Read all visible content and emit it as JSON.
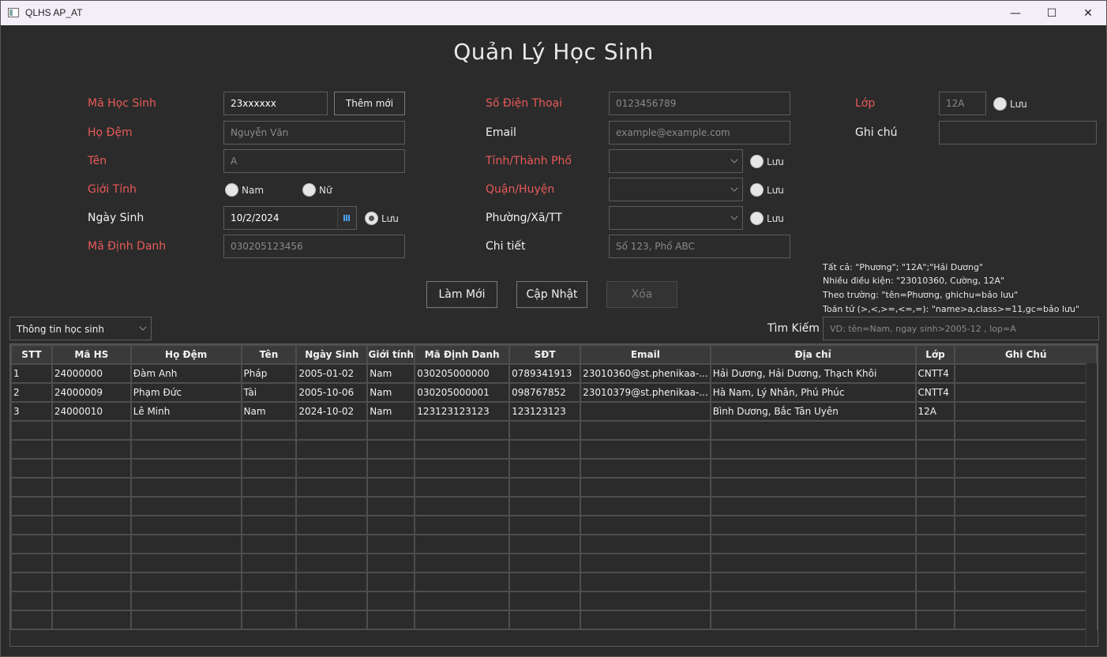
{
  "window": {
    "title": "QLHS AP_AT",
    "minimize": "—",
    "maximize": "☐",
    "close": "✕"
  },
  "header": {
    "title": "Quản Lý Học Sinh"
  },
  "form": {
    "ma_hs": {
      "label": "Mã Học Sinh",
      "value": "23xxxxxx",
      "add_button": "Thêm mới"
    },
    "ho_dem": {
      "label": "Họ Đệm",
      "placeholder": "Nguyễn Văn"
    },
    "ten": {
      "label": "Tên",
      "placeholder": "A"
    },
    "gioi_tinh": {
      "label": "Giới Tính",
      "opt_male": "Nam",
      "opt_female": "Nữ"
    },
    "ngay_sinh": {
      "label": "Ngày Sinh",
      "value": "10/2/2024",
      "save_label": "Lưu"
    },
    "ma_dinh_danh": {
      "label": "Mã Định Danh",
      "placeholder": "030205123456"
    },
    "sdt": {
      "label": "Số Điện Thoại",
      "placeholder": "0123456789"
    },
    "email": {
      "label": "Email",
      "placeholder": "example@example.com"
    },
    "tinh": {
      "label": "Tỉnh/Thành Phố",
      "save_label": "Lưu"
    },
    "quan": {
      "label": "Quận/Huyện",
      "save_label": "Lưu"
    },
    "phuong": {
      "label": "Phường/Xã/TT",
      "save_label": "Lưu"
    },
    "chi_tiet": {
      "label": "Chi tiết",
      "placeholder": "Số 123, Phố ABC"
    },
    "lop": {
      "label": "Lớp",
      "placeholder": "12A",
      "save_label": "Lưu"
    },
    "ghi_chu": {
      "label": "Ghi chú",
      "value": ""
    }
  },
  "actions": {
    "refresh": "Làm Mới",
    "update": "Cập Nhật",
    "delete": "Xóa"
  },
  "hints": {
    "line1": "Tất cả: \"Phương\"; \"12A\";\"Hải Dương\"",
    "line2": "Nhiều điều kiện: \"23010360, Cường, 12A\"",
    "line3": "Theo trường: \"tên=Phương, ghichu=bảo lưu\"",
    "line4": "Toán tử (>,<,>=,<=,=): \"name>a,class>=11,gc=bảo lưu\""
  },
  "view_select": {
    "value": "Thông tin học sinh"
  },
  "search": {
    "label": "Tìm Kiếm",
    "placeholder": "VD: tên=Nam, ngay sinh>2005-12 , lop=A"
  },
  "table": {
    "columns": [
      "STT",
      "Mã HS",
      "Họ Đệm",
      "Tên",
      "Ngày Sinh",
      "Giới tính",
      "Mã Định Danh",
      "SĐT",
      "Email",
      "Địa chỉ",
      "Lớp",
      "Ghi Chú"
    ],
    "rows": [
      [
        "1",
        "24000000",
        "Đàm Anh",
        "Pháp",
        "2005-01-02",
        "Nam",
        "030205000000",
        "0789341913",
        "23010360@st.phenikaa-...",
        "Hải Dương, Hải Dương, Thạch Khôi",
        "CNTT4",
        ""
      ],
      [
        "2",
        "24000009",
        "Phạm Đức",
        "Tài",
        "2005-10-06",
        "Nam",
        "030205000001",
        "098767852",
        "23010379@st.phenikaa-...",
        "Hà Nam, Lý Nhân, Phú Phúc",
        "CNTT4",
        ""
      ],
      [
        "3",
        "24000010",
        "Lê Minh",
        "Nam",
        "2024-10-02",
        "Nam",
        "123123123123",
        "123123123",
        "",
        "Bình Dương, Bắc Tân Uyên",
        "12A",
        ""
      ]
    ]
  }
}
